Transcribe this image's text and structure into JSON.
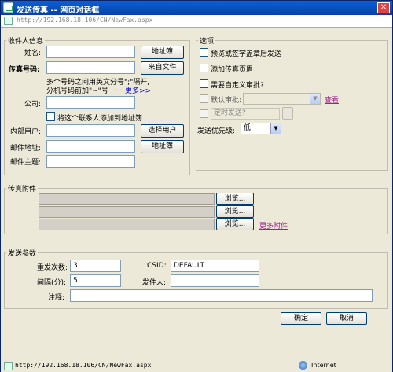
{
  "window": {
    "title": "发送传真 -- 网页对话框",
    "url": "http://192.168.18.106/CN/NewFax.aspx"
  },
  "recipient": {
    "legend": "收件人信息",
    "name_label": "姓名:",
    "name_value": "",
    "address_book_button": "地址簿",
    "fax_label": "传真号码:",
    "fax_value": "",
    "from_file_button": "来自文件",
    "hint_line1": "多个号码之间用英文分号\";\"隔开,",
    "hint_line2": "分机号码前加\"~\"号",
    "hint_ellipsis": "...",
    "more_link": "更多>>",
    "company_label": "公司:",
    "company_value": "",
    "add_contact_label": "将这个联系人添加到地址簿",
    "internal_user_label": "内部用户:",
    "internal_user_value": "",
    "select_user_button": "选择用户",
    "email_label": "邮件地址:",
    "email_value": "",
    "email_address_book_button": "地址簿",
    "email_subject_label": "邮件主题:",
    "email_subject_value": ""
  },
  "options": {
    "legend": "选项",
    "preview_label": "预览或签字盖章后发送",
    "header_label": "添加传真页眉",
    "custom_approval_label": "需要自定义审批?",
    "default_approval_label": "默认审批:",
    "default_approval_value": "",
    "view_link": "查看",
    "scheduled_label": "定时发送?",
    "priority_label": "发送优先级:",
    "priority_value": "低"
  },
  "attachments": {
    "legend": "传真附件",
    "browse_label": "浏览...",
    "more_link": "更多附件",
    "count": 3
  },
  "params": {
    "legend": "发送参数",
    "retry_label": "重发次数:",
    "retry_value": "3",
    "csid_label": "CSID:",
    "csid_value": "DEFAULT",
    "interval_label": "间隔(分):",
    "interval_value": "5",
    "sender_label": "发件人:",
    "sender_value": "",
    "note_label": "注释:",
    "note_value": ""
  },
  "footer": {
    "ok_button": "确定",
    "cancel_button": "取消"
  },
  "statusbar": {
    "url": "http://192.168.18.106/CN/NewFax.aspx",
    "zone": "Internet"
  }
}
